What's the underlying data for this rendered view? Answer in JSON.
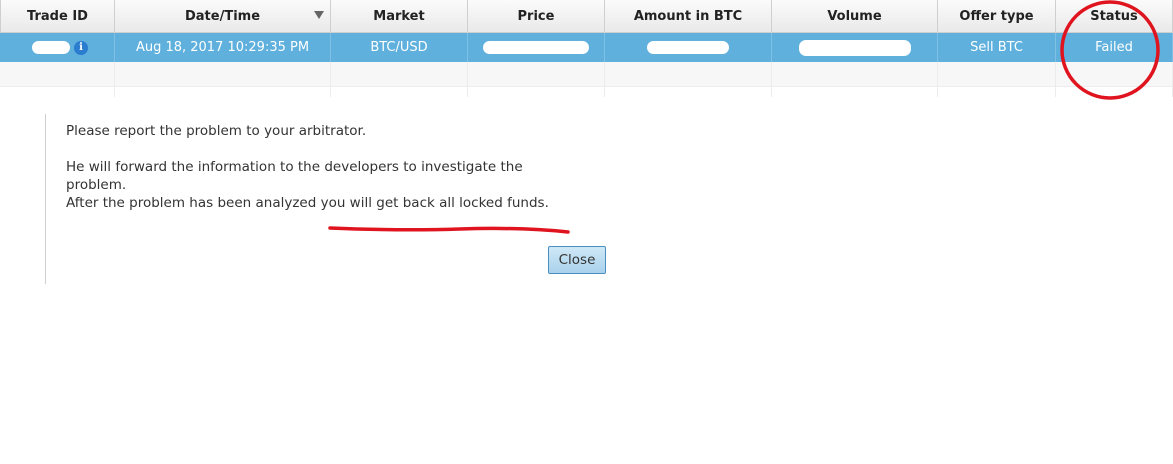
{
  "table": {
    "headers": {
      "trade_id": "Trade ID",
      "date_time": "Date/Time",
      "market": "Market",
      "price": "Price",
      "amount": "Amount in BTC",
      "volume": "Volume",
      "offer_type": "Offer type",
      "status": "Status"
    },
    "selected_row": {
      "trade_id": "",
      "date_time": "Aug 18, 2017 10:29:35 PM",
      "market": "BTC/USD",
      "price": "",
      "amount": "",
      "volume": "",
      "offer_type": "Sell BTC",
      "status": "Failed"
    },
    "sort_icon": "sort-descending-icon",
    "info_icon_glyph": "i"
  },
  "dialog": {
    "line1": "Please report the problem to your arbitrator.",
    "line2": "He will forward the information to the developers to investigate the problem.",
    "line3": "After the problem has been analyzed you will get back all locked funds.",
    "close_label": "Close"
  },
  "colors": {
    "selected_row": "#5fb0dd",
    "annotation": "#e0141e",
    "button_border": "#4a8fc0"
  }
}
